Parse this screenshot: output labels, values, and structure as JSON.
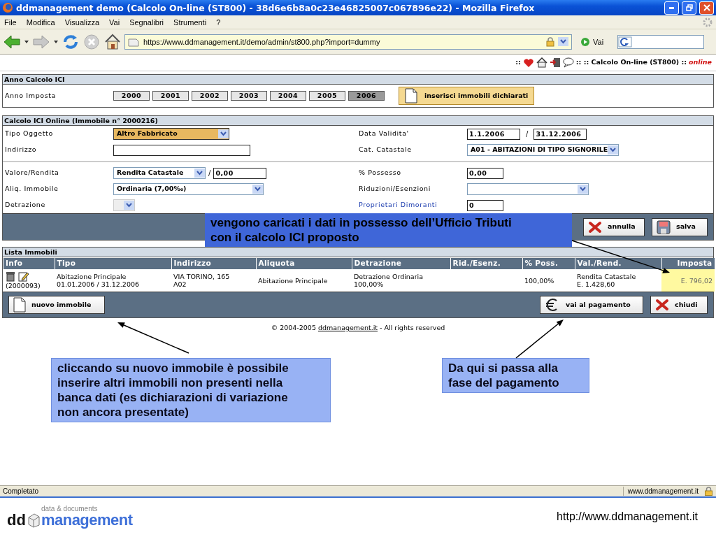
{
  "window": {
    "title": "ddmanagement demo (Calcolo On-line (ST800) - 38d6e6b8a0c23e46825007c067896e22) - Mozilla Firefox"
  },
  "menu": [
    "File",
    "Modifica",
    "Visualizza",
    "Vai",
    "Segnalibri",
    "Strumenti",
    "?"
  ],
  "toolbar": {
    "url": "https://www.ddmanagement.it/demo/admin/st800.php?import=dummy",
    "go": "Vai"
  },
  "header": {
    "prefix": "::",
    "path": ":: :: Calcolo On-line (ST800) ::",
    "status": "online"
  },
  "year_panel": {
    "title": "Anno Calcolo ICI",
    "label": "Anno Imposta",
    "years": [
      {
        "label": "2000",
        "selected": false
      },
      {
        "label": "2001",
        "selected": false
      },
      {
        "label": "2002",
        "selected": false
      },
      {
        "label": "2003",
        "selected": false
      },
      {
        "label": "2004",
        "selected": false
      },
      {
        "label": "2005",
        "selected": false
      },
      {
        "label": "2006",
        "selected": true
      }
    ],
    "action": "inserisci immobili dichiarati"
  },
  "calc_panel": {
    "title": "Calcolo ICI Online (Immobile n° 2000216)",
    "groups": [
      [
        {
          "left": {
            "label": "Tipo Oggetto",
            "kind": "select",
            "value": "Altro Fabbricato",
            "highlighted": true
          },
          "right": {
            "label": "Data Validita'",
            "kind": "range",
            "from": "1.1.2006",
            "separator": "/",
            "to": "31.12.2006"
          }
        },
        {
          "left": {
            "label": "Indirizzo",
            "kind": "input"
          },
          "right": {
            "label": "Cat. Catastale",
            "kind": "select",
            "value": "A01 - ABITAZIONI DI TIPO SIGNORILE"
          }
        }
      ],
      [
        {
          "left": {
            "label": "Valore/Rendita",
            "kind": "select-input",
            "value": "Rendita Catastale",
            "separator": "/",
            "input": "0,00"
          },
          "right": {
            "label": "% Possesso",
            "kind": "input",
            "value": "0,00"
          }
        },
        {
          "left": {
            "label": "Aliq. Immobile",
            "kind": "select",
            "value": "Ordinaria (7,00‰)"
          },
          "right": {
            "label": "Riduzioni/Esenzioni",
            "kind": "select"
          }
        },
        {
          "left": {
            "label": "Detrazione",
            "kind": "select",
            "disabled": true
          },
          "right": {
            "label": "Proprietari Dimoranti",
            "kind": "input",
            "value": "0",
            "linked": true
          }
        }
      ]
    ],
    "buttons": [
      {
        "label": "annulla",
        "kind": "cancel"
      },
      {
        "label": "salva",
        "kind": "save"
      }
    ]
  },
  "list": {
    "title": "Lista Immobili",
    "columns": [
      "Info",
      "Tipo",
      "Indirizzo",
      "Aliquota",
      "Detrazione",
      "Rid./Esenz.",
      "% Poss.",
      "Val./Rend.",
      "Imposta"
    ],
    "rows": [
      {
        "cells": [
          {
            "kind": "info",
            "lines": [
              "(2000093)"
            ]
          },
          {
            "lines": [
              "Abitazione Principale",
              "01.01.2006 / 31.12.2006"
            ]
          },
          {
            "lines": [
              "VIA TORINO, 165",
              "A02"
            ]
          },
          {
            "lines": [
              "Abitazione Principale"
            ]
          },
          {
            "lines": [
              "Detrazione Ordinaria",
              "100,00%"
            ]
          },
          {},
          {
            "lines": [
              "100,00%"
            ]
          },
          {
            "lines": [
              "Rendita Catastale",
              "E. 1.428,60"
            ]
          },
          {
            "lines": [
              "E. 796,02"
            ],
            "highlighted": true
          }
        ]
      }
    ],
    "buttons": [
      {
        "label": "nuovo immobile",
        "kind": "new"
      },
      {
        "label": "vai al pagamento",
        "kind": "pay"
      },
      {
        "label": "chiudi",
        "kind": "close"
      }
    ]
  },
  "footer": {
    "copyright": "© 2004-2005",
    "link": "ddmanagement.it",
    "rights": "- All rights reserved"
  },
  "status_bar": {
    "text": "Completato",
    "site": "www.ddmanagement.it"
  },
  "slide": {
    "logo_dd": "dd",
    "logo_small": "data & documents",
    "logo_main": "management",
    "url": "http://www.ddmanagement.it"
  },
  "callouts": [
    {
      "kind": "dark",
      "lines": [
        "vengono caricati i dati in possesso dell’Ufficio Tributi",
        "con il calcolo ICI proposto"
      ]
    },
    {
      "kind": "light",
      "lines": [
        "cliccando su nuovo immobile è possibile",
        "inserire altri immobili non presenti nella",
        "banca dati (es dichiarazioni di variazione",
        "non ancora presentate)"
      ]
    },
    {
      "kind": "light",
      "lines": [
        "Da qui si passa alla",
        "fase del pagamento"
      ]
    }
  ]
}
